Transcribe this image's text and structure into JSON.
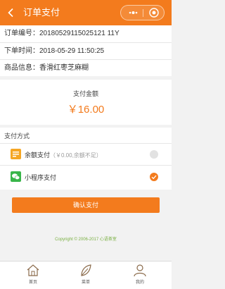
{
  "navbar": {
    "title": "订单支付"
  },
  "order": {
    "order_no": "订单编号：20180529115025121 11Y",
    "order_time": "下单时间：2018-05-29 11:50:25",
    "product_info": "商品信息：香滑红枣芝麻糊"
  },
  "amount": {
    "label": "支付金额",
    "value": "￥16.00"
  },
  "payment": {
    "title": "支付方式",
    "methods": [
      {
        "label": "余额支付",
        "note": "（￥0.00,余额不足）",
        "selected": false
      },
      {
        "label": "小程序支付",
        "note": "",
        "selected": true
      }
    ]
  },
  "confirm_label": "确认支付",
  "copyright": "Copyright © 2006-2017 心语茶室",
  "tabbar": [
    {
      "label": "首页",
      "icon": "home-icon"
    },
    {
      "label": "菜单",
      "icon": "leaf-icon"
    },
    {
      "label": "我的",
      "icon": "user-icon"
    }
  ],
  "colors": {
    "accent": "#f37b1d",
    "copyright": "#7ab043",
    "wechat": "#39b54a",
    "balance": "#f5a623"
  }
}
